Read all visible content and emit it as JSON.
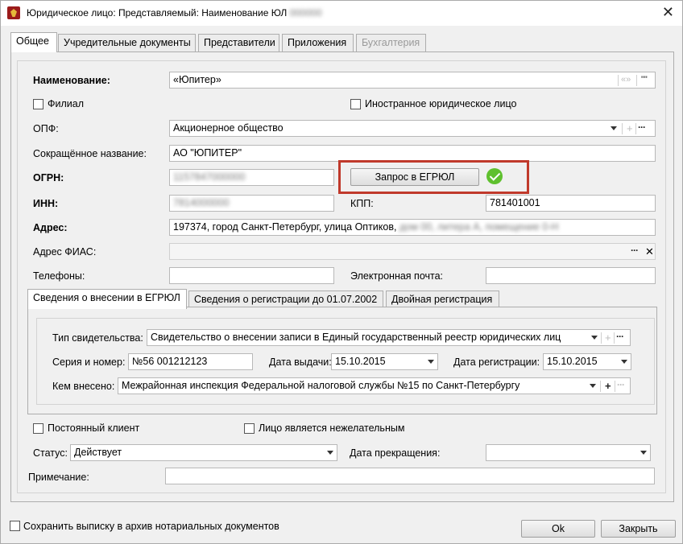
{
  "window": {
    "title": "Юридическое лицо: Представляемый: Наименование ЮЛ",
    "title_blurred": "000000"
  },
  "tabs": [
    {
      "label": "Общее"
    },
    {
      "label": "Учредительные документы"
    },
    {
      "label": "Представители"
    },
    {
      "label": "Приложения"
    },
    {
      "label": "Бухгалтерия"
    }
  ],
  "form": {
    "name_label": "Наименование:",
    "name_value": "«Юпитер»",
    "quote_btn1": "«»",
    "quote_btn2": "\"\"",
    "branch_label": "Филиал",
    "foreign_label": "Иностранное юридическое лицо",
    "opf_label": "ОПФ:",
    "opf_value": "Акционерное общество",
    "short_name_label": "Сокращённое название:",
    "short_name_value": "АО \"ЮПИТЕР\"",
    "ogrn_label": "ОГРН:",
    "ogrn_value": "1157847000000",
    "egrul_button": "Запрос в ЕГРЮЛ",
    "inn_label": "ИНН:",
    "inn_value": "7814000000",
    "kpp_label": "КПП:",
    "kpp_value": "781401001",
    "address_label": "Адрес:",
    "address_value": "197374, город Санкт-Петербург, улица Оптиков,",
    "address_blurred": "дом 00, литера А, помещение 0-Н",
    "fias_label": "Адрес ФИАС:",
    "phones_label": "Телефоны:",
    "email_label": "Электронная почта:"
  },
  "subtabs": [
    {
      "label": "Сведения о внесении в ЕГРЮЛ"
    },
    {
      "label": "Сведения о регистрации до 01.07.2002"
    },
    {
      "label": "Двойная регистрация"
    }
  ],
  "egrul": {
    "cert_type_label": "Тип свидетельства:",
    "cert_type_value": "Свидетельство о внесении записи в Единый государственный реестр юридических лиц",
    "series_label": "Серия и номер:",
    "series_value": "№56 001212123",
    "issue_date_label": "Дата выдачи:",
    "issue_date_value": "15.10.2015",
    "reg_date_label": "Дата регистрации:",
    "reg_date_value": "15.10.2015",
    "issued_by_label": "Кем внесено:",
    "issued_by_value": "Межрайонная инспекция Федеральной налоговой службы №15 по Санкт-Петербургу"
  },
  "lower": {
    "regular_client_label": "Постоянный клиент",
    "undesirable_label": "Лицо является нежелательным",
    "status_label": "Статус:",
    "status_value": "Действует",
    "end_date_label": "Дата прекращения:",
    "note_label": "Примечание:"
  },
  "footer": {
    "archive_label": "Сохранить выписку в архив нотариальных документов",
    "ok_label": "Ok",
    "close_label": "Закрыть"
  }
}
